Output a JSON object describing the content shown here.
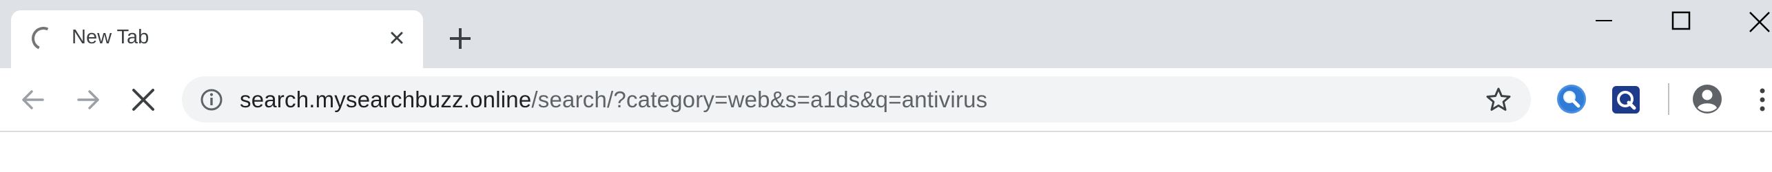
{
  "tab": {
    "title": "New Tab",
    "loading": true
  },
  "icons": {
    "tab_spinner": "loading-spinner-icon",
    "tab_close": "close-icon",
    "new_tab": "plus-icon",
    "minimize": "minimize-icon",
    "maximize": "maximize-icon",
    "close_window": "close-icon",
    "back": "arrow-left-icon",
    "forward": "arrow-right-icon",
    "stop": "stop-loading-icon",
    "site_info": "info-icon",
    "bookmark": "star-icon",
    "extension_1": "magnifier-extension-icon",
    "extension_2": "search-q-extension-icon",
    "profile": "profile-icon",
    "menu": "kebab-menu-icon"
  },
  "omnibox": {
    "url_host": "search.mysearchbuzz.online",
    "url_path": "/search/?category=web&s=a1ds&q=antivirus"
  },
  "colors": {
    "tabstrip_bg": "#dee1e6",
    "omnibox_bg": "#f1f3f4",
    "extension_1_accent": "#1a73e8",
    "extension_2_accent": "#1e3a8a"
  }
}
